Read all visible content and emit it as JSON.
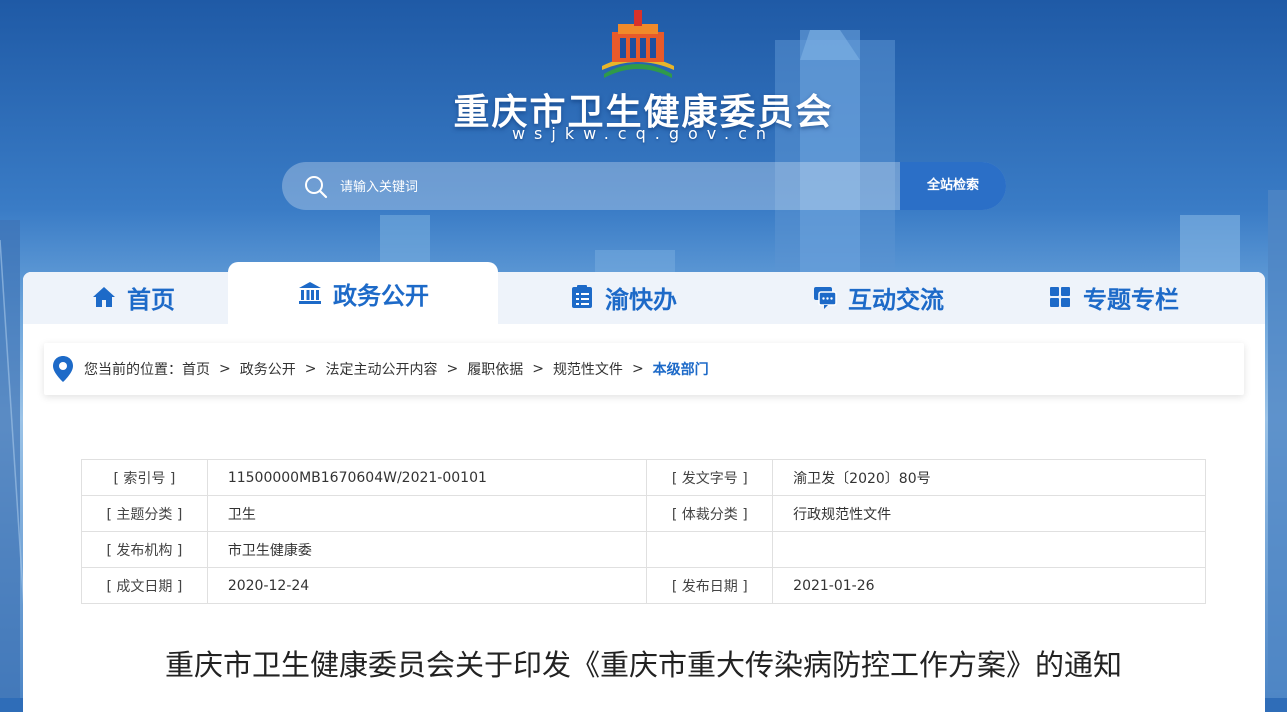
{
  "header": {
    "title": "重庆市卫生健康委员会",
    "domain": "wsjkw.cq.gov.cn"
  },
  "search": {
    "placeholder": "请输入关键词",
    "button_label": "全站检索"
  },
  "nav": {
    "tabs": [
      {
        "label": "首页",
        "icon": "home-icon"
      },
      {
        "label": "政务公开",
        "icon": "government-building-icon",
        "active": true
      },
      {
        "label": "渝快办",
        "icon": "clipboard-checklist-icon"
      },
      {
        "label": "互动交流",
        "icon": "chat-bubble-icon"
      },
      {
        "label": "专题专栏",
        "icon": "grid-icon"
      }
    ]
  },
  "breadcrumb": {
    "prefix": "您当前的位置：",
    "items": [
      "首页",
      "政务公开",
      "法定主动公开内容",
      "履职依据",
      "规范性文件"
    ],
    "separator": ">",
    "current": "本级部门"
  },
  "metadata": {
    "rows": [
      {
        "l1": "[ 索引号 ]",
        "v1": "11500000MB1670604W/2021-00101",
        "l2": "[ 发文字号 ]",
        "v2": "渝卫发〔2020〕80号"
      },
      {
        "l1": "[ 主题分类 ]",
        "v1": "卫生",
        "l2": "[ 体裁分类 ]",
        "v2": "行政规范性文件"
      },
      {
        "l1": "[ 发布机构 ]",
        "v1": "市卫生健康委",
        "l2": "",
        "v2": ""
      },
      {
        "l1": "[ 成文日期 ]",
        "v1": "2020-12-24",
        "l2": "[ 发布日期 ]",
        "v2": "2021-01-26"
      }
    ]
  },
  "document": {
    "title": "重庆市卫生健康委员会关于印发《重庆市重大传染病防控工作方案》的通知"
  },
  "colors": {
    "accent": "#1d6ac8",
    "search_button": "#2b6fc7"
  }
}
